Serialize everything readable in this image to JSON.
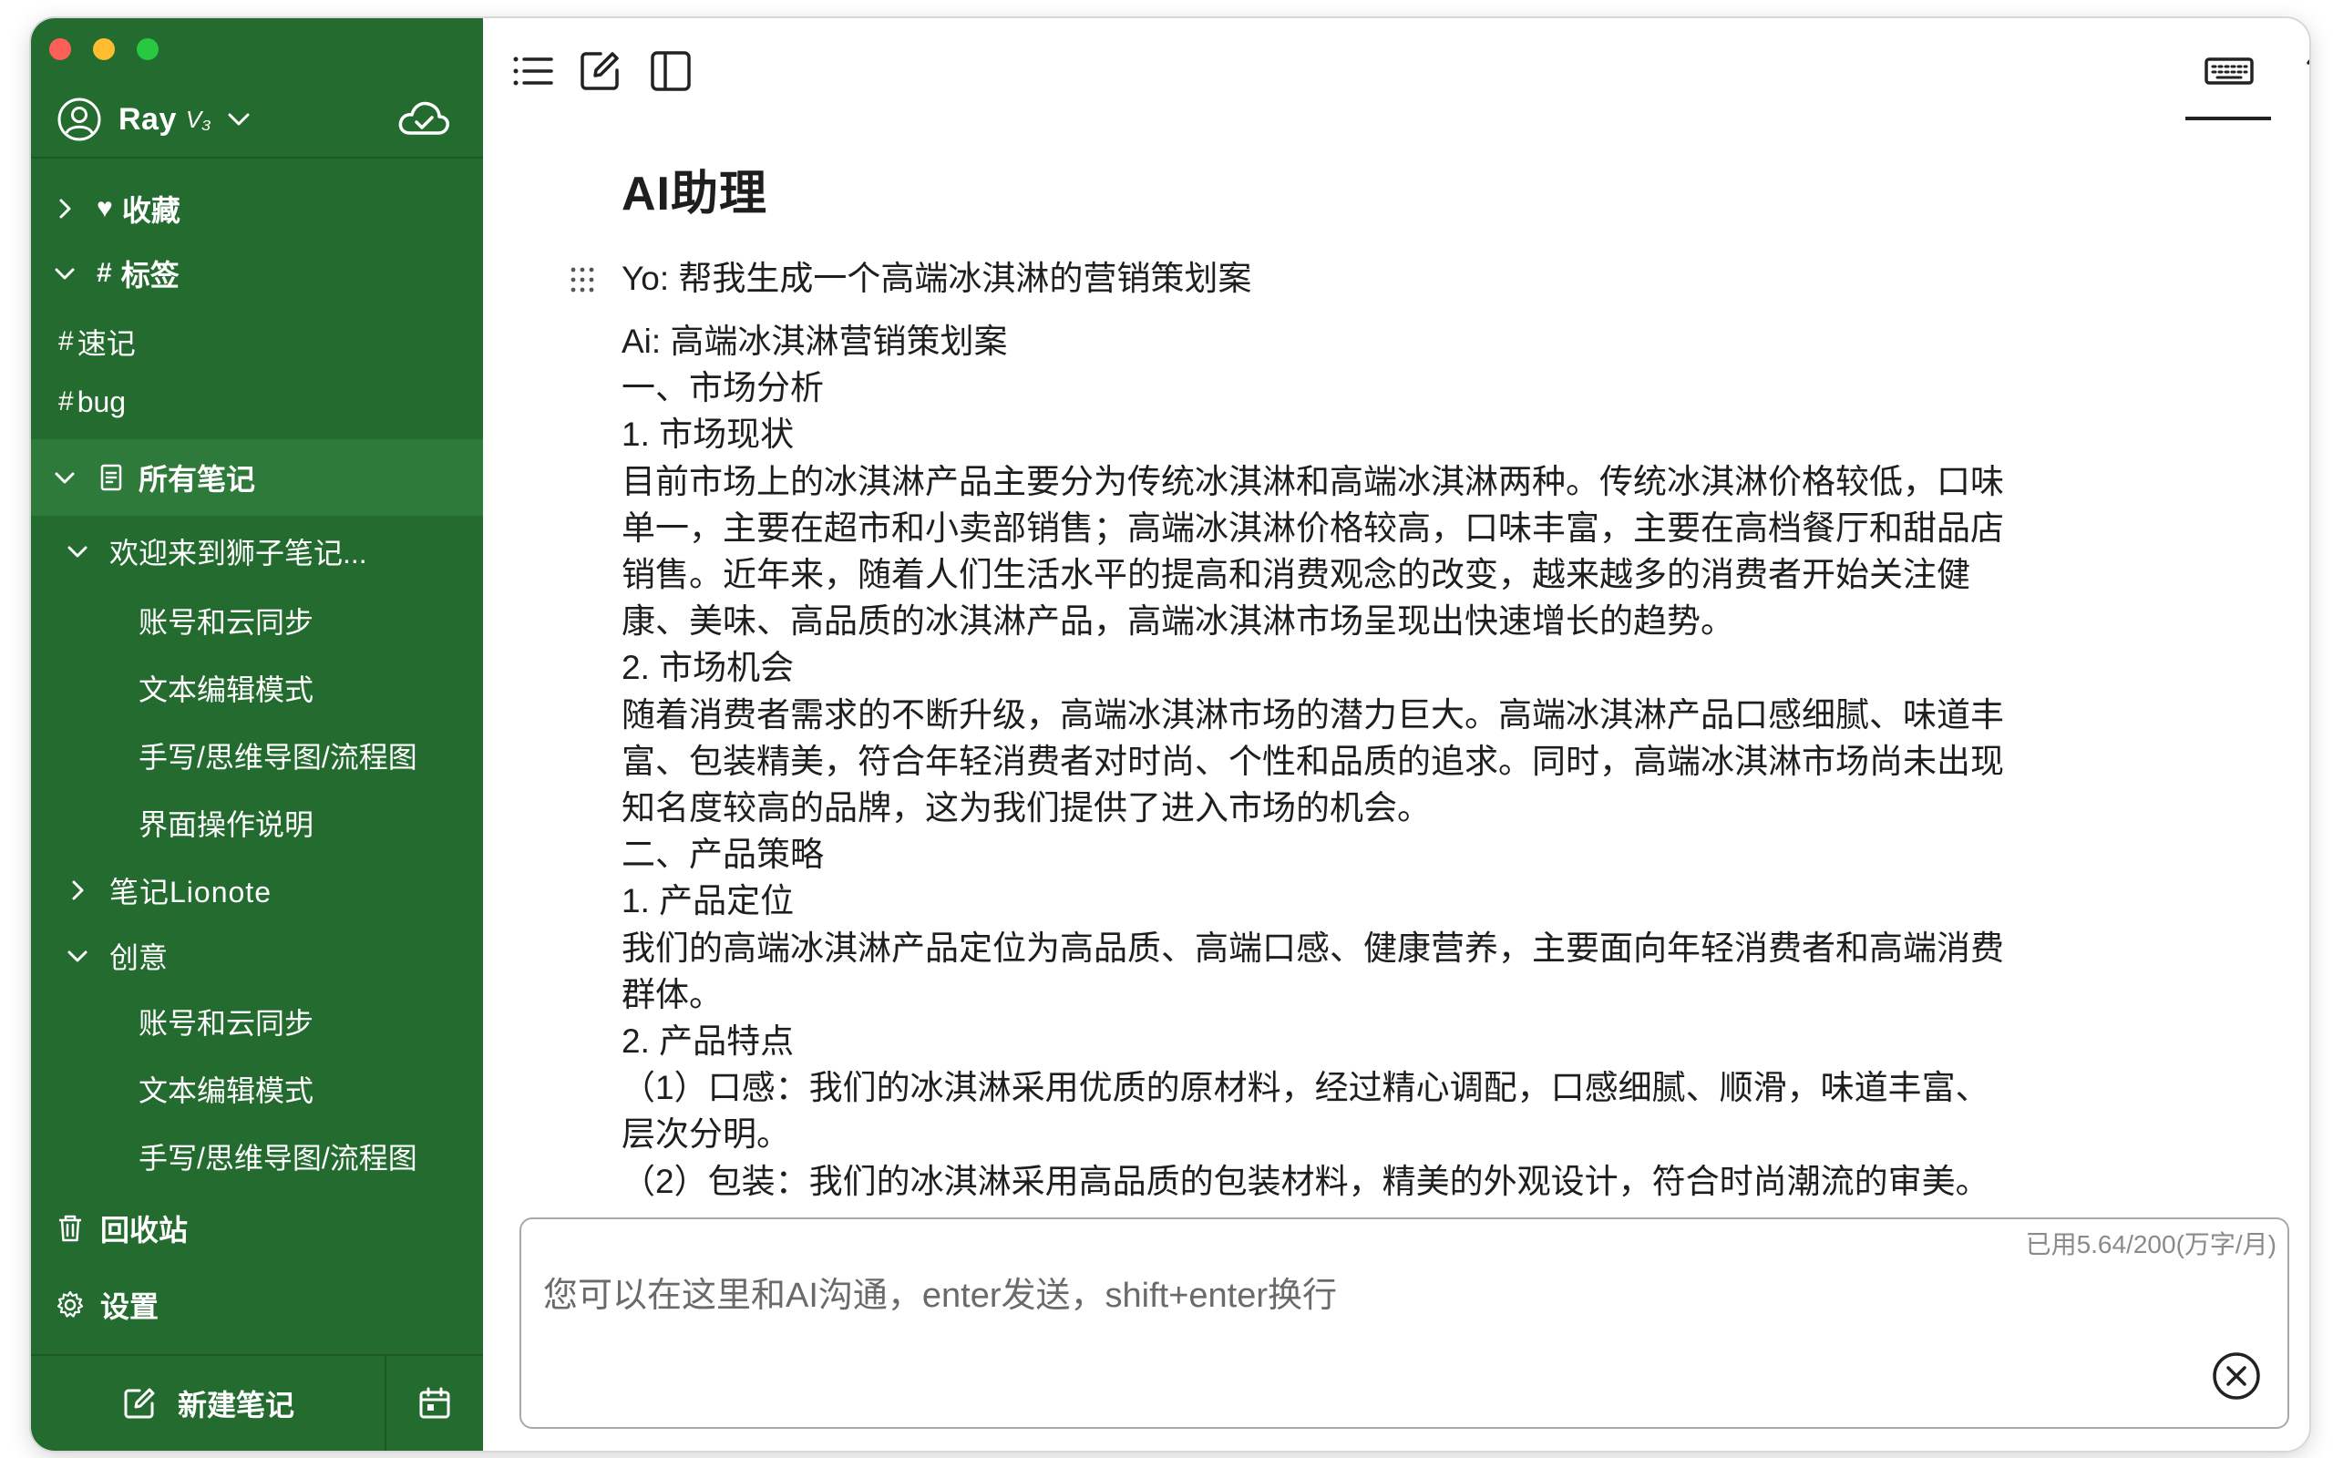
{
  "sidebar": {
    "user": {
      "name": "Ray",
      "badge": "V₃"
    },
    "items": [
      {
        "label": "收藏",
        "glyph": "♥",
        "expanded": false
      },
      {
        "label": "标签",
        "glyph": "#",
        "expanded": true
      },
      {
        "label": "速记",
        "glyph": "#"
      },
      {
        "label": "bug",
        "glyph": "#"
      },
      {
        "label": "所有笔记",
        "expanded": true,
        "active": true
      },
      {
        "label": "欢迎来到狮子笔记...",
        "expanded": true
      },
      {
        "label": "账号和云同步"
      },
      {
        "label": "文本编辑模式"
      },
      {
        "label": "手写/思维导图/流程图"
      },
      {
        "label": "界面操作说明"
      },
      {
        "label": "笔记Lionote",
        "expanded": false
      },
      {
        "label": "创意",
        "expanded": true
      },
      {
        "label": "账号和云同步"
      },
      {
        "label": "文本编辑模式"
      },
      {
        "label": "手写/思维导图/流程图"
      },
      {
        "label": "回收站"
      },
      {
        "label": "设置"
      }
    ],
    "new_note_label": "新建笔记"
  },
  "toolbar": {
    "left_icons": [
      "outline-list-icon",
      "edit-icon",
      "split-panel-icon"
    ],
    "right_icons": [
      "keyboard-icon",
      "handwriting-icon",
      "mindmap-icon",
      "flowchart-icon",
      "table-icon",
      "favorite-heart-icon",
      "more-dots-icon"
    ],
    "active": "keyboard-icon"
  },
  "document": {
    "title": "AI助理",
    "question": "Yo: 帮我生成一个高端冰淇淋的营销策划案",
    "lines": [
      "Ai: 高端冰淇淋营销策划案",
      "一、市场分析",
      "1. 市场现状",
      "目前市场上的冰淇淋产品主要分为传统冰淇淋和高端冰淇淋两种。传统冰淇淋价格较低，口味",
      "单一，主要在超市和小卖部销售；高端冰淇淋价格较高，口味丰富，主要在高档餐厅和甜品店",
      "销售。近年来，随着人们生活水平的提高和消费观念的改变，越来越多的消费者开始关注健",
      "康、美味、高品质的冰淇淋产品，高端冰淇淋市场呈现出快速增长的趋势。",
      "2. 市场机会",
      "随着消费者需求的不断升级，高端冰淇淋市场的潜力巨大。高端冰淇淋产品口感细腻、味道丰",
      "富、包装精美，符合年轻消费者对时尚、个性和品质的追求。同时，高端冰淇淋市场尚未出现",
      "知名度较高的品牌，这为我们提供了进入市场的机会。",
      "二、产品策略",
      "1. 产品定位",
      "我们的高端冰淇淋产品定位为高品质、高端口感、健康营养，主要面向年轻消费者和高端消费",
      "群体。",
      "2. 产品特点",
      "（1）口感：我们的冰淇淋采用优质的原材料，经过精心调配，口感细腻、顺滑，味道丰富、",
      "层次分明。",
      "（2）包装：我们的冰淇淋采用高品质的包装材料，精美的外观设计，符合时尚潮流的审美。"
    ]
  },
  "chat": {
    "usage": "已用5.64/200(万字/月)",
    "placeholder": "您可以在这里和AI沟通，enter发送，shift+enter换行"
  }
}
